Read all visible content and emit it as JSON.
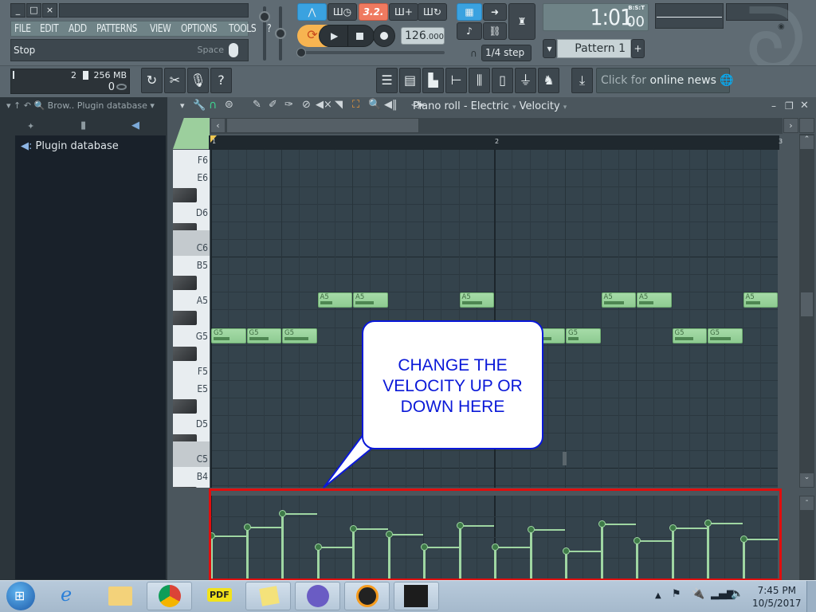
{
  "window": {
    "minimize_label": "_",
    "maximize_label": "□",
    "close_label": "×"
  },
  "menu": [
    "FILE",
    "EDIT",
    "ADD",
    "PATTERNS",
    "VIEW",
    "OPTIONS",
    "TOOLS",
    "?"
  ],
  "hint_bar": {
    "text": "Stop",
    "shortcut": "Space"
  },
  "transport": {
    "pattern_song_mode": "3.2.",
    "tempo_int": "126",
    "tempo_frac": ".000",
    "snap": "1/4 step",
    "clock_main": "1:01",
    "clock_ticks": "00",
    "clock_format": "B:S:T",
    "pattern": "Pattern 1"
  },
  "cpu_panel": {
    "polyphony": "2",
    "memory": "256 MB",
    "cpu_value": "0"
  },
  "news": {
    "prefix": "Click for",
    "link": "online news"
  },
  "browser": {
    "header": "Brow.. Plugin database",
    "item": "Plugin database"
  },
  "piano_roll": {
    "title": "Piano roll - Electric",
    "target": "Velocity",
    "bars": [
      "1",
      "2",
      "3"
    ],
    "key_labels": [
      "F6",
      "E6",
      "D6",
      "C6",
      "B5",
      "A5",
      "G5",
      "F5",
      "E5",
      "D5",
      "C5",
      "B4"
    ],
    "steps_per_bar": 16,
    "visible_steps": 32,
    "notes": [
      {
        "key": "G5",
        "start": 0,
        "length": 2,
        "velocity": 0.53
      },
      {
        "key": "G5",
        "start": 2,
        "length": 2,
        "velocity": 0.63
      },
      {
        "key": "G5",
        "start": 4,
        "length": 2,
        "velocity": 0.79
      },
      {
        "key": "A5",
        "start": 6,
        "length": 2,
        "velocity": 0.4
      },
      {
        "key": "A5",
        "start": 8,
        "length": 2,
        "velocity": 0.61
      },
      {
        "key": "G5",
        "start": 10,
        "length": 2,
        "velocity": 0.55
      },
      {
        "key": "G5",
        "start": 12,
        "length": 2,
        "velocity": 0.4
      },
      {
        "key": "A5",
        "start": 14,
        "length": 2,
        "velocity": 0.65
      },
      {
        "key": "G5",
        "start": 16,
        "length": 2,
        "velocity": 0.4
      },
      {
        "key": "G5",
        "start": 18,
        "length": 2,
        "velocity": 0.6
      },
      {
        "key": "G5",
        "start": 20,
        "length": 2,
        "velocity": 0.35
      },
      {
        "key": "A5",
        "start": 22,
        "length": 2,
        "velocity": 0.67
      },
      {
        "key": "A5",
        "start": 24,
        "length": 2,
        "velocity": 0.47
      },
      {
        "key": "G5",
        "start": 26,
        "length": 2,
        "velocity": 0.62
      },
      {
        "key": "G5",
        "start": 28,
        "length": 2,
        "velocity": 0.68
      },
      {
        "key": "A5",
        "start": 30,
        "length": 2,
        "velocity": 0.49
      }
    ]
  },
  "annotation": {
    "text_lines": [
      "CHANGE THE",
      "VELOCITY UP OR",
      "DOWN HERE"
    ]
  },
  "tray": {
    "time": "7:45 PM",
    "date": "10/5/2017"
  },
  "colors": {
    "note": "#9fd6a2",
    "callout": "#0a18d8",
    "highlight_frame": "#e00e0e"
  }
}
